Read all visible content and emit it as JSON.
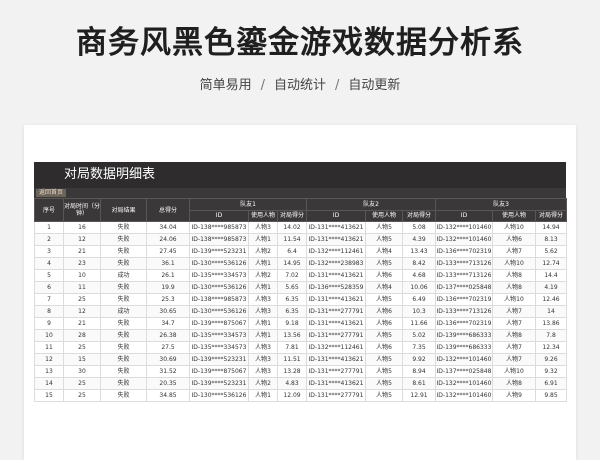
{
  "header": {
    "title": "商务风黑色鎏金游戏数据分析系",
    "subtitle_items": [
      "简单易用",
      "自动统计",
      "自动更新"
    ],
    "separator": "/"
  },
  "sheet": {
    "title": "对局数据明细表",
    "back_button": "返回首页",
    "columns": {
      "seq": "序号",
      "time": "对局时间（分钟）",
      "result": "对局结果",
      "total": "总得分",
      "teams": [
        "队友1",
        "队友2",
        "队友3"
      ],
      "sub": [
        "ID",
        "使用人物",
        "对局得分"
      ]
    },
    "rows": [
      [
        "1",
        "16",
        "失败",
        "34.04",
        "ID-138****985873",
        "人物3",
        "14.02",
        "ID-131****413621",
        "人物5",
        "5.08",
        "ID-132****101460",
        "人物10",
        "14.94"
      ],
      [
        "2",
        "12",
        "失败",
        "24.06",
        "ID-138****985873",
        "人物1",
        "11.54",
        "ID-131****413621",
        "人物5",
        "4.39",
        "ID-132****101460",
        "人物6",
        "8.13"
      ],
      [
        "3",
        "21",
        "失败",
        "27.45",
        "ID-139****523231",
        "人物2",
        "6.4",
        "ID-132****112461",
        "人物4",
        "13.43",
        "ID-136****702319",
        "人物7",
        "5.62"
      ],
      [
        "4",
        "23",
        "失败",
        "36.1",
        "ID-130****536126",
        "人物1",
        "14.95",
        "ID-132****238983",
        "人物5",
        "8.42",
        "ID-133****713126",
        "人物10",
        "12.74"
      ],
      [
        "5",
        "10",
        "成功",
        "26.1",
        "ID-135****334573",
        "人物2",
        "7.02",
        "ID-131****413621",
        "人物6",
        "4.68",
        "ID-133****713126",
        "人物8",
        "14.4"
      ],
      [
        "6",
        "11",
        "失败",
        "19.9",
        "ID-130****536126",
        "人物1",
        "5.65",
        "ID-136****528359",
        "人物4",
        "10.06",
        "ID-137****025848",
        "人物8",
        "4.19"
      ],
      [
        "7",
        "25",
        "失败",
        "25.3",
        "ID-138****985873",
        "人物3",
        "6.35",
        "ID-131****413621",
        "人物5",
        "6.49",
        "ID-136****702319",
        "人物10",
        "12.46"
      ],
      [
        "8",
        "12",
        "成功",
        "30.65",
        "ID-130****536126",
        "人物3",
        "6.35",
        "ID-131****277791",
        "人物6",
        "10.3",
        "ID-133****713126",
        "人物7",
        "14"
      ],
      [
        "9",
        "21",
        "失败",
        "34.7",
        "ID-139****875067",
        "人物1",
        "9.18",
        "ID-131****413621",
        "人物6",
        "11.66",
        "ID-136****702319",
        "人物7",
        "13.86"
      ],
      [
        "10",
        "28",
        "失败",
        "26.38",
        "ID-135****334573",
        "人物1",
        "13.56",
        "ID-131****277791",
        "人物5",
        "5.02",
        "ID-139****686333",
        "人物8",
        "7.8"
      ],
      [
        "11",
        "25",
        "失败",
        "27.5",
        "ID-135****334573",
        "人物3",
        "7.81",
        "ID-132****112461",
        "人物6",
        "7.35",
        "ID-139****686333",
        "人物7",
        "12.34"
      ],
      [
        "12",
        "15",
        "失败",
        "30.69",
        "ID-139****523231",
        "人物3",
        "11.51",
        "ID-131****413621",
        "人物5",
        "9.92",
        "ID-132****101460",
        "人物7",
        "9.26"
      ],
      [
        "13",
        "30",
        "失败",
        "31.52",
        "ID-139****875067",
        "人物3",
        "13.28",
        "ID-131****277791",
        "人物5",
        "8.94",
        "ID-137****025848",
        "人物10",
        "9.32"
      ],
      [
        "14",
        "25",
        "失败",
        "20.35",
        "ID-139****523231",
        "人物2",
        "4.83",
        "ID-131****413621",
        "人物5",
        "8.61",
        "ID-132****101460",
        "人物8",
        "6.91"
      ],
      [
        "15",
        "25",
        "失败",
        "34.85",
        "ID-130****536126",
        "人物1",
        "12.09",
        "ID-131****277791",
        "人物5",
        "12.91",
        "ID-132****101460",
        "人物9",
        "9.85"
      ]
    ]
  }
}
